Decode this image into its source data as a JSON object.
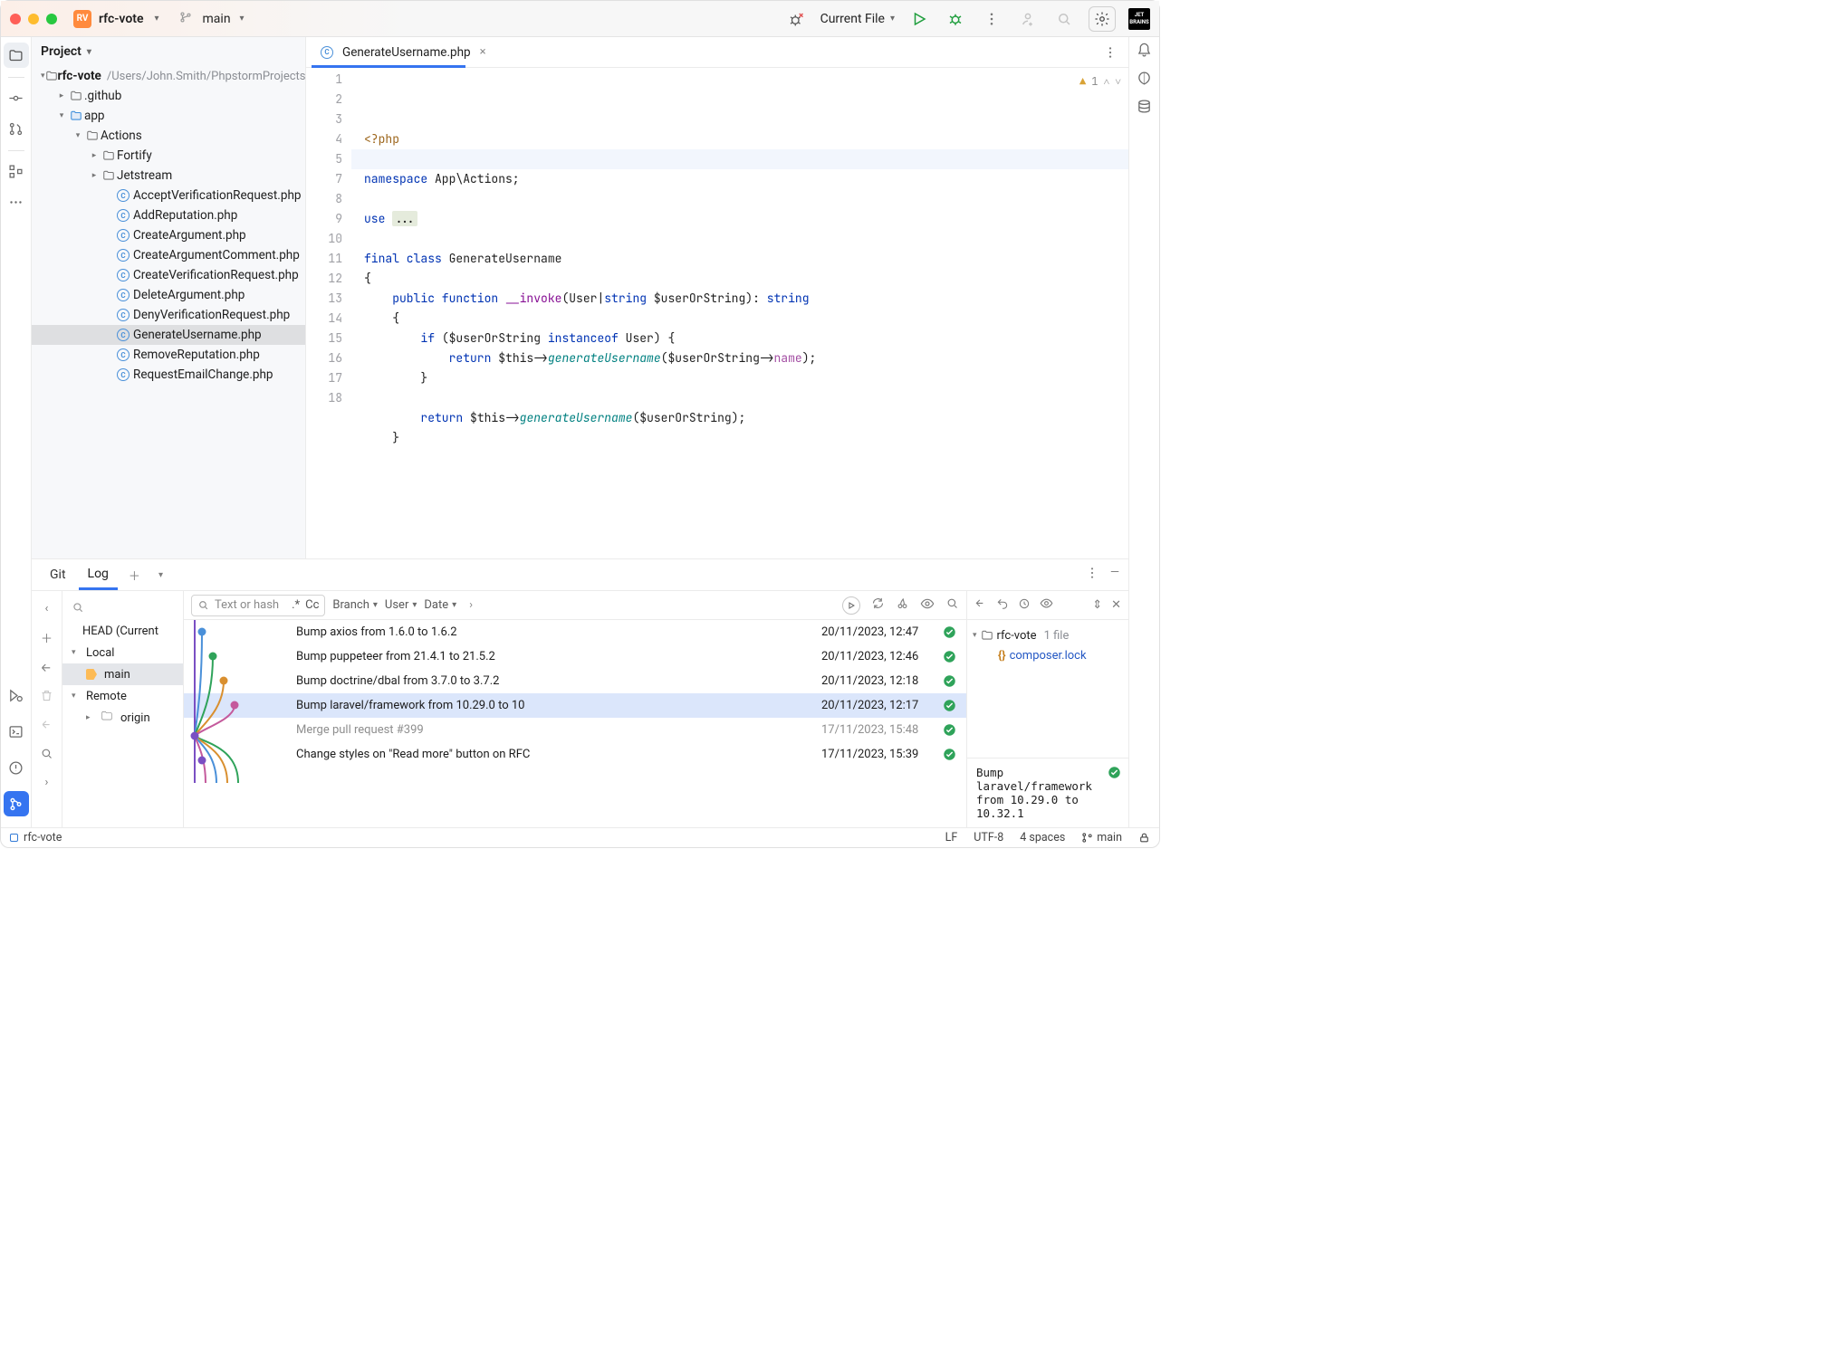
{
  "titlebar": {
    "project_icon_text": "RV",
    "project_name": "rfc-vote",
    "branch_name": "main",
    "run_config": "Current File"
  },
  "project_tool": {
    "title": "Project",
    "root_name": "rfc-vote",
    "root_path": "/Users/John.Smith/PhpstormProjects/",
    "nodes": {
      "github": ".github",
      "app": "app",
      "actions": "Actions",
      "fortify": "Fortify",
      "jetstream": "Jetstream"
    },
    "files": [
      "AcceptVerificationRequest.php",
      "AddReputation.php",
      "CreateArgument.php",
      "CreateArgumentComment.php",
      "CreateVerificationRequest.php",
      "DeleteArgument.php",
      "DenyVerificationRequest.php",
      "GenerateUsername.php",
      "RemoveReputation.php",
      "RequestEmailChange.php"
    ]
  },
  "editor": {
    "tab_name": "GenerateUsername.php",
    "warning_count": "1",
    "lines": [
      {
        "n": "1",
        "html": "<span class='tag'>&lt;?php</span>"
      },
      {
        "n": "2",
        "html": ""
      },
      {
        "n": "3",
        "html": "<span class='kw'>namespace</span> App\\Actions;"
      },
      {
        "n": "4",
        "html": ""
      },
      {
        "n": "5",
        "html": "<span class='kw'>use</span> <span class='fold'>...</span>"
      },
      {
        "n": "7",
        "html": ""
      },
      {
        "n": "8",
        "html": "<span class='kw'>final class</span> GenerateUsername"
      },
      {
        "n": "9",
        "html": "{"
      },
      {
        "n": "10",
        "html": "    <span class='kw'>public function</span> <span class='mag'>__invoke</span>(User|<span class='kw'>string</span> <span class='muted'>$userOrString</span>): <span class='kw'>string</span>"
      },
      {
        "n": "11",
        "html": "    {"
      },
      {
        "n": "12",
        "html": "        <span class='kw'>if</span> (<span class='muted'>$userOrString</span> <span class='kw'>instanceof</span> User) {"
      },
      {
        "n": "13",
        "html": "            <span class='kw'>return</span> <span class='muted'>$this</span>-&gt;<span class='fn'>generateUsername</span>(<span class='muted'>$userOrString</span>-&gt;<span class='prop'>name</span>);"
      },
      {
        "n": "14",
        "html": "        }"
      },
      {
        "n": "15",
        "html": ""
      },
      {
        "n": "16",
        "html": "        <span class='kw'>return</span> <span class='muted'>$this</span>-&gt;<span class='fn'>generateUsername</span>(<span class='muted'>$userOrString</span>);"
      },
      {
        "n": "17",
        "html": "    }"
      },
      {
        "n": "18",
        "html": ""
      }
    ]
  },
  "git": {
    "tab_git": "Git",
    "tab_log": "Log",
    "search_placeholder": "Text or hash",
    "regex": ".*",
    "case": "Cc",
    "filter_branch": "Branch",
    "filter_user": "User",
    "filter_date": "Date",
    "branches_head": "HEAD (Current",
    "branches_local": "Local",
    "branches_main": "main",
    "branches_remote": "Remote",
    "branches_origin": "origin",
    "commits": [
      {
        "msg": "Bump axios from 1.6.0 to 1.6.2",
        "date": "20/11/2023, 12:47",
        "muted": false
      },
      {
        "msg": "Bump puppeteer from 21.4.1 to 21.5.2",
        "date": "20/11/2023, 12:46",
        "muted": false
      },
      {
        "msg": "Bump doctrine/dbal from 3.7.0 to 3.7.2",
        "date": "20/11/2023, 12:18",
        "muted": false
      },
      {
        "msg": "Bump laravel/framework from 10.29.0 to 10",
        "date": "20/11/2023, 12:17",
        "muted": false,
        "sel": true
      },
      {
        "msg": "Merge pull request #399",
        "date": "17/11/2023, 15:48",
        "muted": true
      },
      {
        "msg": "Change styles on \"Read more\" button on RFC",
        "date": "17/11/2023, 15:39",
        "muted": false
      }
    ],
    "details_root": "rfc-vote",
    "details_file_count": "1 file",
    "details_file": "composer.lock",
    "details_msg_l1": "Bump laravel/framework",
    "details_msg_l2": "from 10.29.0 to 10.32.1"
  },
  "status": {
    "project": "rfc-vote",
    "lf": "LF",
    "enc": "UTF-8",
    "indent": "4 spaces",
    "branch": "main"
  }
}
